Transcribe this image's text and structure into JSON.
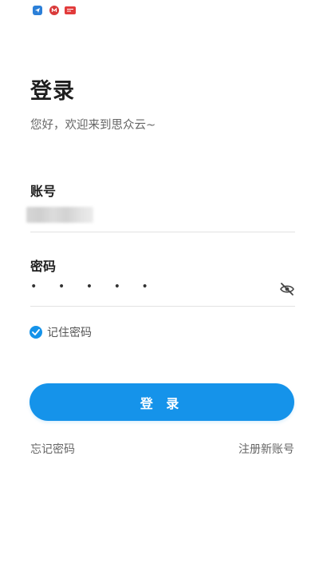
{
  "status_bar": {
    "icons": [
      "send-icon",
      "app-notification-icon",
      "news-app-icon"
    ]
  },
  "login": {
    "title": "登录",
    "subtitle": "您好，欢迎来到思众云~",
    "account_label": "账号",
    "password_label": "密码",
    "password_mask": "• • • • •",
    "remember_label": "记住密码",
    "remember_checked": true,
    "submit_label": "登 录",
    "forgot_link": "忘记密码",
    "register_link": "注册新账号"
  },
  "colors": {
    "accent": "#1593ea",
    "title_text": "#1e1e1e",
    "secondary_text": "#666666",
    "divider": "#e2e2e2"
  }
}
